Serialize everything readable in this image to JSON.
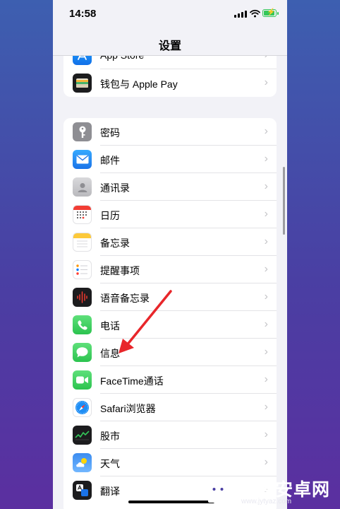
{
  "status": {
    "time": "14:58"
  },
  "nav": {
    "title": "设置"
  },
  "group1": [
    {
      "label": "App Store",
      "icon": "app-store-icon"
    },
    {
      "label": "钱包与 Apple Pay",
      "icon": "wallet-icon"
    }
  ],
  "group2": [
    {
      "label": "密码",
      "icon": "key-icon"
    },
    {
      "label": "邮件",
      "icon": "mail-icon"
    },
    {
      "label": "通讯录",
      "icon": "contacts-icon"
    },
    {
      "label": "日历",
      "icon": "calendar-icon"
    },
    {
      "label": "备忘录",
      "icon": "notes-icon"
    },
    {
      "label": "提醒事项",
      "icon": "reminders-icon"
    },
    {
      "label": "语音备忘录",
      "icon": "voice-memos-icon"
    },
    {
      "label": "电话",
      "icon": "phone-icon"
    },
    {
      "label": "信息",
      "icon": "messages-icon"
    },
    {
      "label": "FaceTime通话",
      "icon": "facetime-icon"
    },
    {
      "label": "Safari浏览器",
      "icon": "safari-icon"
    },
    {
      "label": "股市",
      "icon": "stocks-icon"
    },
    {
      "label": "天气",
      "icon": "weather-icon"
    },
    {
      "label": "翻译",
      "icon": "translate-icon"
    }
  ],
  "watermark": {
    "name": "天源安卓网",
    "url": "www.jytyaz.com"
  },
  "colors": {
    "accent_arrow": "#e8262a",
    "battery": "#34c759",
    "background": "#f2f2f7"
  }
}
